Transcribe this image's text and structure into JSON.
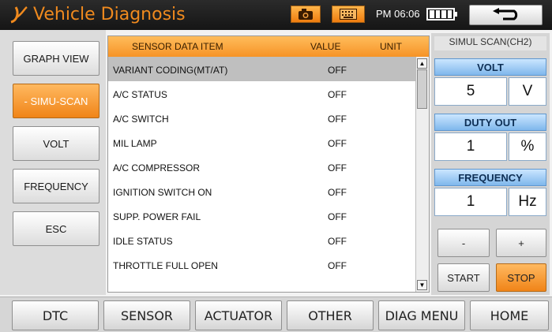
{
  "header": {
    "title": "Vehicle Diagnosis",
    "time": "PM 06:06",
    "icons": [
      "logo-icon",
      "camera-icon",
      "keypad-icon",
      "battery-icon",
      "back-arrow-icon"
    ]
  },
  "left_menu": {
    "items": [
      {
        "label": "GRAPH VIEW",
        "active": false
      },
      {
        "label": "- SIMU-SCAN",
        "active": true
      },
      {
        "label": "VOLT",
        "active": false
      },
      {
        "label": "FREQUENCY",
        "active": false
      },
      {
        "label": "ESC",
        "active": false
      }
    ]
  },
  "table": {
    "columns": [
      "SENSOR DATA ITEM",
      "VALUE",
      "UNIT"
    ],
    "rows": [
      {
        "item": "VARIANT CODING(MT/AT)",
        "value": "OFF",
        "unit": ""
      },
      {
        "item": "A/C STATUS",
        "value": "OFF",
        "unit": ""
      },
      {
        "item": "A/C SWITCH",
        "value": "OFF",
        "unit": ""
      },
      {
        "item": "MIL LAMP",
        "value": "OFF",
        "unit": ""
      },
      {
        "item": "A/C COMPRESSOR",
        "value": "OFF",
        "unit": ""
      },
      {
        "item": "IGNITION SWITCH ON",
        "value": "OFF",
        "unit": ""
      },
      {
        "item": "SUPP. POWER FAIL",
        "value": "OFF",
        "unit": ""
      },
      {
        "item": "IDLE STATUS",
        "value": "OFF",
        "unit": ""
      },
      {
        "item": "THROTTLE FULL OPEN",
        "value": "OFF",
        "unit": ""
      }
    ],
    "selected_row": 0
  },
  "simul_panel": {
    "title": "SIMUL SCAN(CH2)",
    "volt": {
      "label": "VOLT",
      "value": "5",
      "unit": "V"
    },
    "duty": {
      "label": "DUTY OUT",
      "value": "1",
      "unit": "%"
    },
    "frequency": {
      "label": "FREQUENCY",
      "value": "1",
      "unit": "Hz"
    },
    "minus": "-",
    "plus": "+",
    "start": "START",
    "stop": "STOP"
  },
  "bottom_nav": [
    "DTC",
    "SENSOR",
    "ACTUATOR",
    "OTHER",
    "DIAG MENU",
    "HOME"
  ],
  "colors": {
    "accent_orange": "#f08418",
    "title_orange": "#f08a1e",
    "header_blue": "#7fb7ec",
    "titlebar_black": "#1a1a1a"
  }
}
